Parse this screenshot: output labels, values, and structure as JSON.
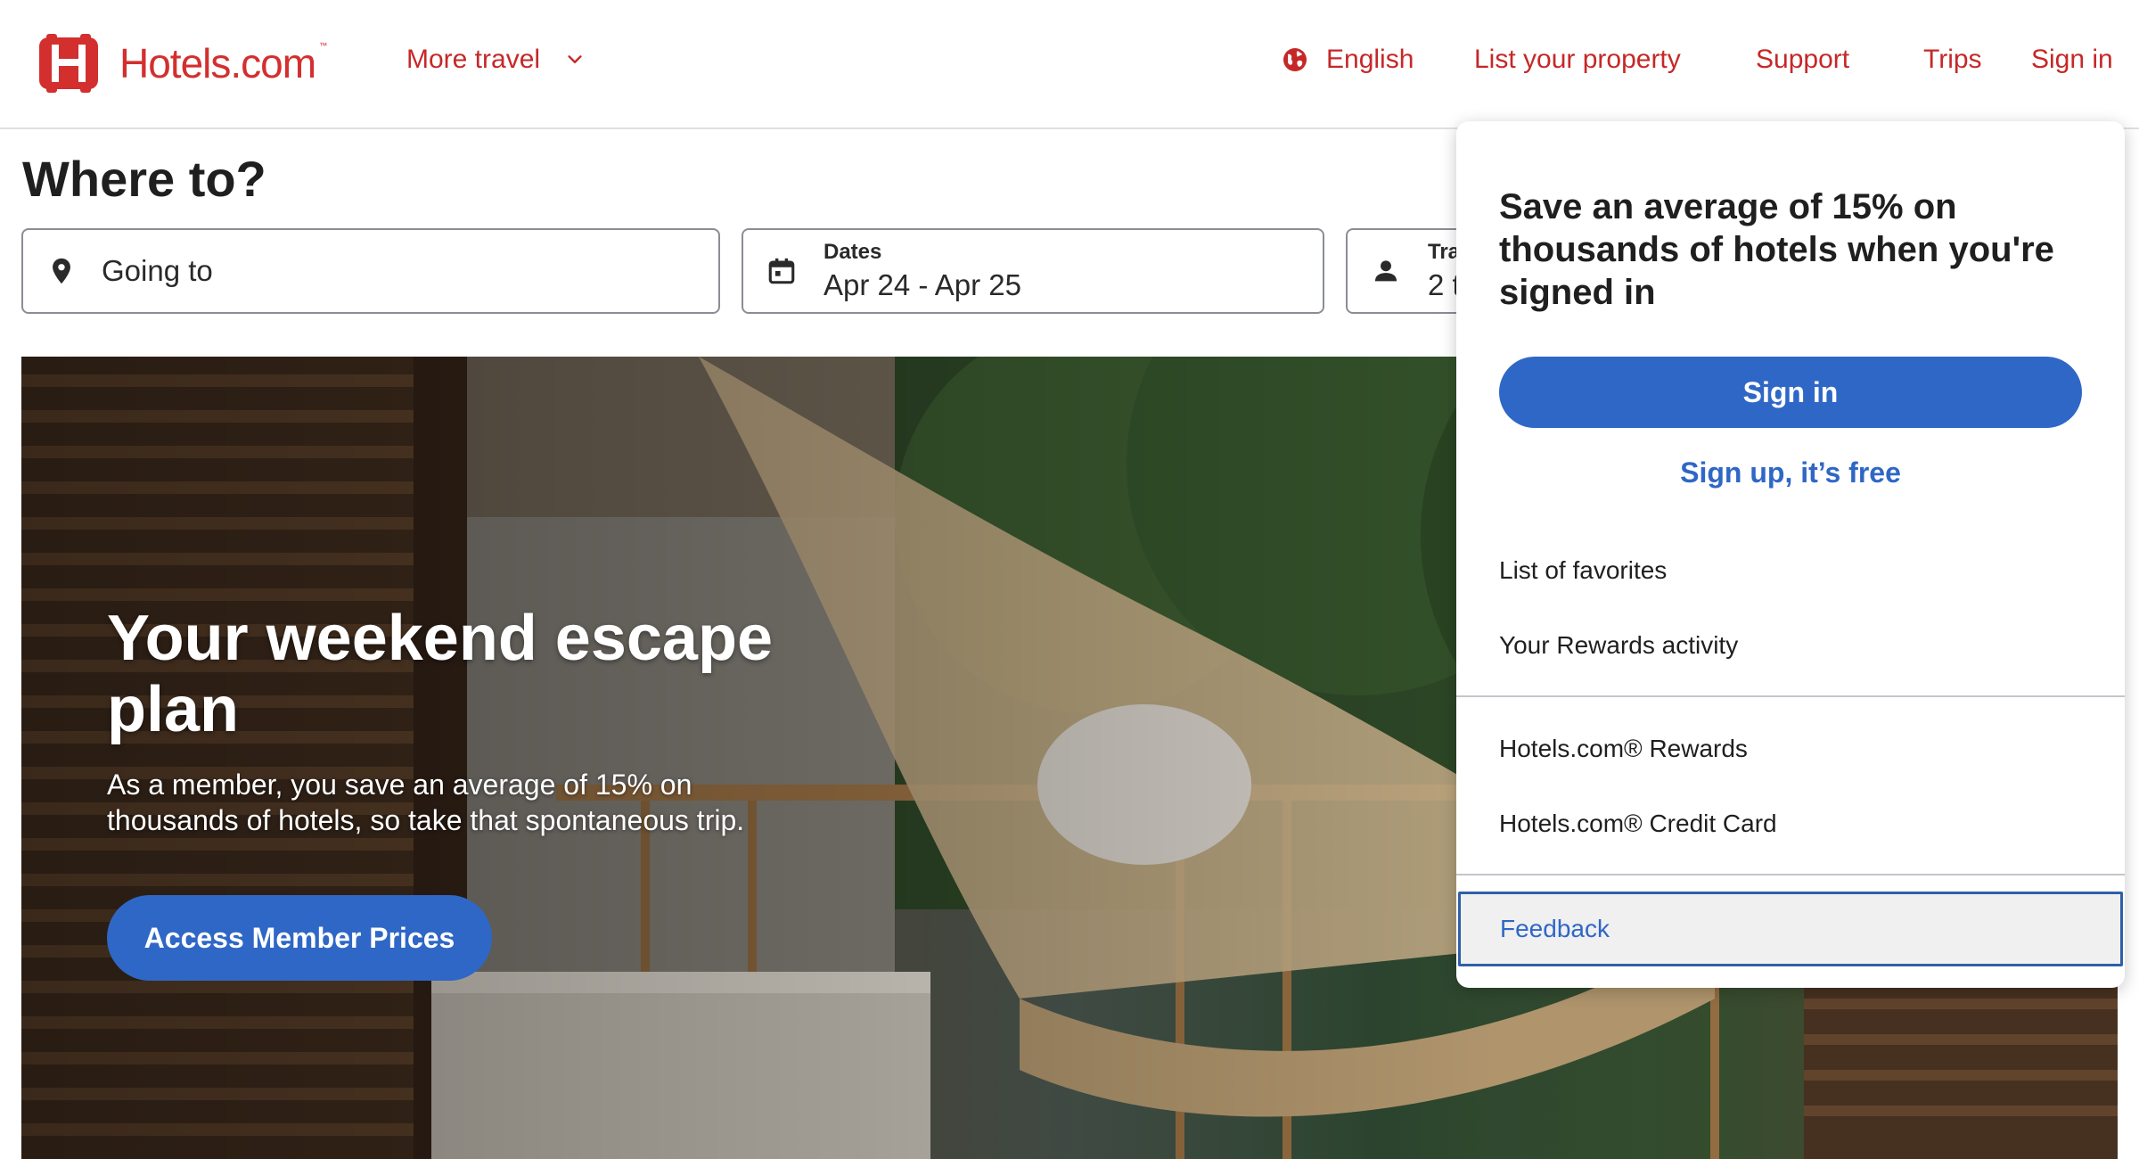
{
  "header": {
    "brand": "Hotels.com",
    "brand_tm": "™",
    "brand_color": "#d32f2f",
    "nav": {
      "more_travel": "More travel",
      "language": "English",
      "list_property": "List your property",
      "support": "Support",
      "trips": "Trips",
      "sign_in": "Sign in"
    }
  },
  "search": {
    "title": "Where to?",
    "going_to_placeholder": "Going to",
    "dates_label": "Dates",
    "dates_value": "Apr 24 - Apr 25",
    "travelers_label": "Tra",
    "travelers_value": "2 t"
  },
  "hero": {
    "title": "Your weekend escape plan",
    "body": "As a member, you save an average of 15% on thousands of hotels, so take that spontaneous trip.",
    "cta": "Access Member Prices"
  },
  "dropdown": {
    "headline": "Save an average of 15% on thousands of hotels when you're signed in",
    "sign_in": "Sign in",
    "sign_up": "Sign up, it’s free",
    "items": {
      "favorites": "List of favorites",
      "rewards_activity": "Your Rewards activity",
      "rewards": "Hotels.com® Rewards",
      "credit_card": "Hotels.com® Credit Card",
      "feedback": "Feedback"
    }
  },
  "colors": {
    "accent_blue": "#2f67c6",
    "brand_red": "#d32f2f"
  }
}
